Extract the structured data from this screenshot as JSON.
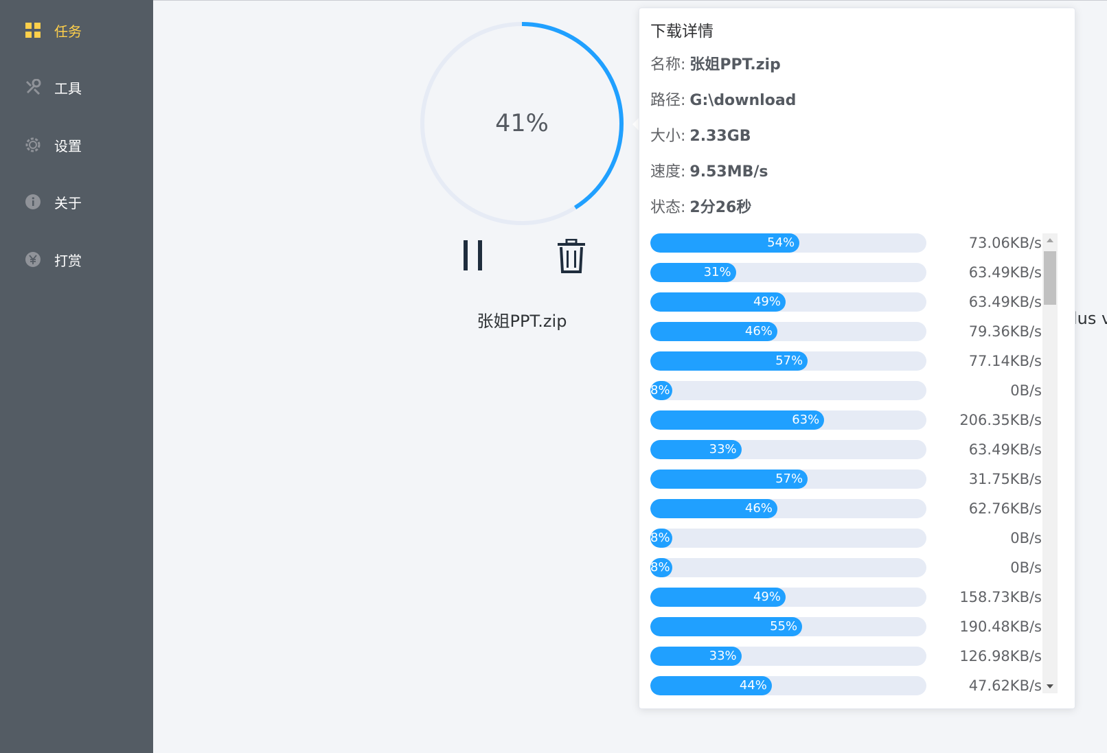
{
  "sidebar": {
    "bg": "#545c64",
    "active_color": "#ffd04b",
    "items": [
      {
        "label": "任务",
        "icon": "grid-icon",
        "active": true
      },
      {
        "label": "工具",
        "icon": "wrench-icon",
        "active": false
      },
      {
        "label": "设置",
        "icon": "gear-icon",
        "active": false
      },
      {
        "label": "关于",
        "icon": "info-icon",
        "active": false
      },
      {
        "label": "打赏",
        "icon": "yuan-icon",
        "active": false
      }
    ]
  },
  "task": {
    "progress_text": "41%",
    "progress": 0.41,
    "name": "张姐PPT.zip",
    "pause_icon": "pause-icon",
    "delete_icon": "trash-icon",
    "accent": "#20a0ff"
  },
  "next_card_peek": "lus v",
  "details": {
    "title": "下载详情",
    "name_label": "名称:",
    "name_value": "张姐PPT.zip",
    "path_label": "路径:",
    "path_value": "G:\\download",
    "size_label": "大小:",
    "size_value": "2.33GB",
    "speed_label": "速度:",
    "speed_value": "9.53MB/s",
    "status_label": "状态:",
    "status_value": "2分26秒"
  },
  "chunks": [
    {
      "percent": 54,
      "label": "54%",
      "speed": "73.06KB/s"
    },
    {
      "percent": 31,
      "label": "31%",
      "speed": "63.49KB/s"
    },
    {
      "percent": 49,
      "label": "49%",
      "speed": "63.49KB/s"
    },
    {
      "percent": 46,
      "label": "46%",
      "speed": "79.36KB/s"
    },
    {
      "percent": 57,
      "label": "57%",
      "speed": "77.14KB/s"
    },
    {
      "percent": 8,
      "label": "8%",
      "speed": "0B/s"
    },
    {
      "percent": 63,
      "label": "63%",
      "speed": "206.35KB/s"
    },
    {
      "percent": 33,
      "label": "33%",
      "speed": "63.49KB/s"
    },
    {
      "percent": 57,
      "label": "57%",
      "speed": "31.75KB/s"
    },
    {
      "percent": 46,
      "label": "46%",
      "speed": "62.76KB/s"
    },
    {
      "percent": 8,
      "label": "8%",
      "speed": "0B/s"
    },
    {
      "percent": 8,
      "label": "8%",
      "speed": "0B/s"
    },
    {
      "percent": 49,
      "label": "49%",
      "speed": "158.73KB/s"
    },
    {
      "percent": 55,
      "label": "55%",
      "speed": "190.48KB/s"
    },
    {
      "percent": 33,
      "label": "33%",
      "speed": "126.98KB/s"
    },
    {
      "percent": 44,
      "label": "44%",
      "speed": "47.62KB/s"
    }
  ]
}
